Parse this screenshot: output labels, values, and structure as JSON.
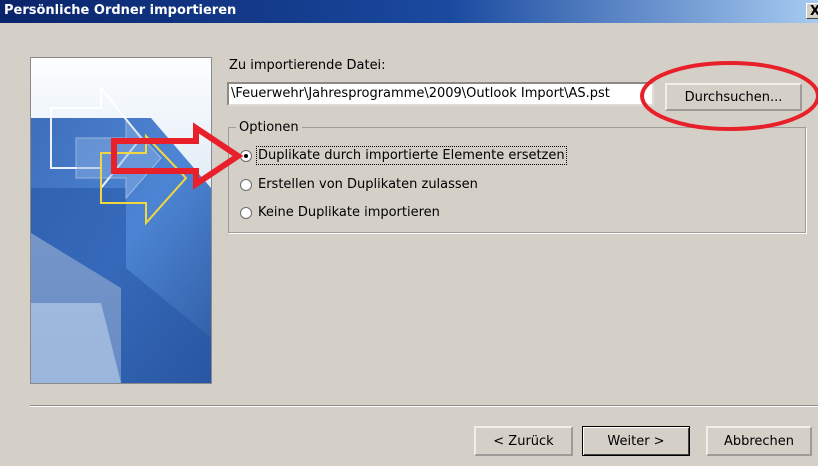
{
  "dialog": {
    "title": "Persönliche Ordner importieren",
    "close_glyph": "X"
  },
  "file": {
    "label": "Zu importierende Datei:",
    "value": "\\Feuerwehr\\Jahresprogramme\\2009\\Outlook Import\\AS.pst",
    "browse_label": "Durchsuchen..."
  },
  "options": {
    "legend": "Optionen",
    "items": [
      {
        "label": "Duplikate durch importierte Elemente ersetzen",
        "selected": true
      },
      {
        "label": "Erstellen von Duplikaten zulassen",
        "selected": false
      },
      {
        "label": "Keine Duplikate importieren",
        "selected": false
      }
    ]
  },
  "buttons": {
    "back": "< Zurück",
    "next": "Weiter >",
    "cancel": "Abbrechen"
  },
  "colors": {
    "titlebar": "#0a246a",
    "dialog_bg": "#d4d0c8",
    "annotation_red": "#e8202a"
  }
}
